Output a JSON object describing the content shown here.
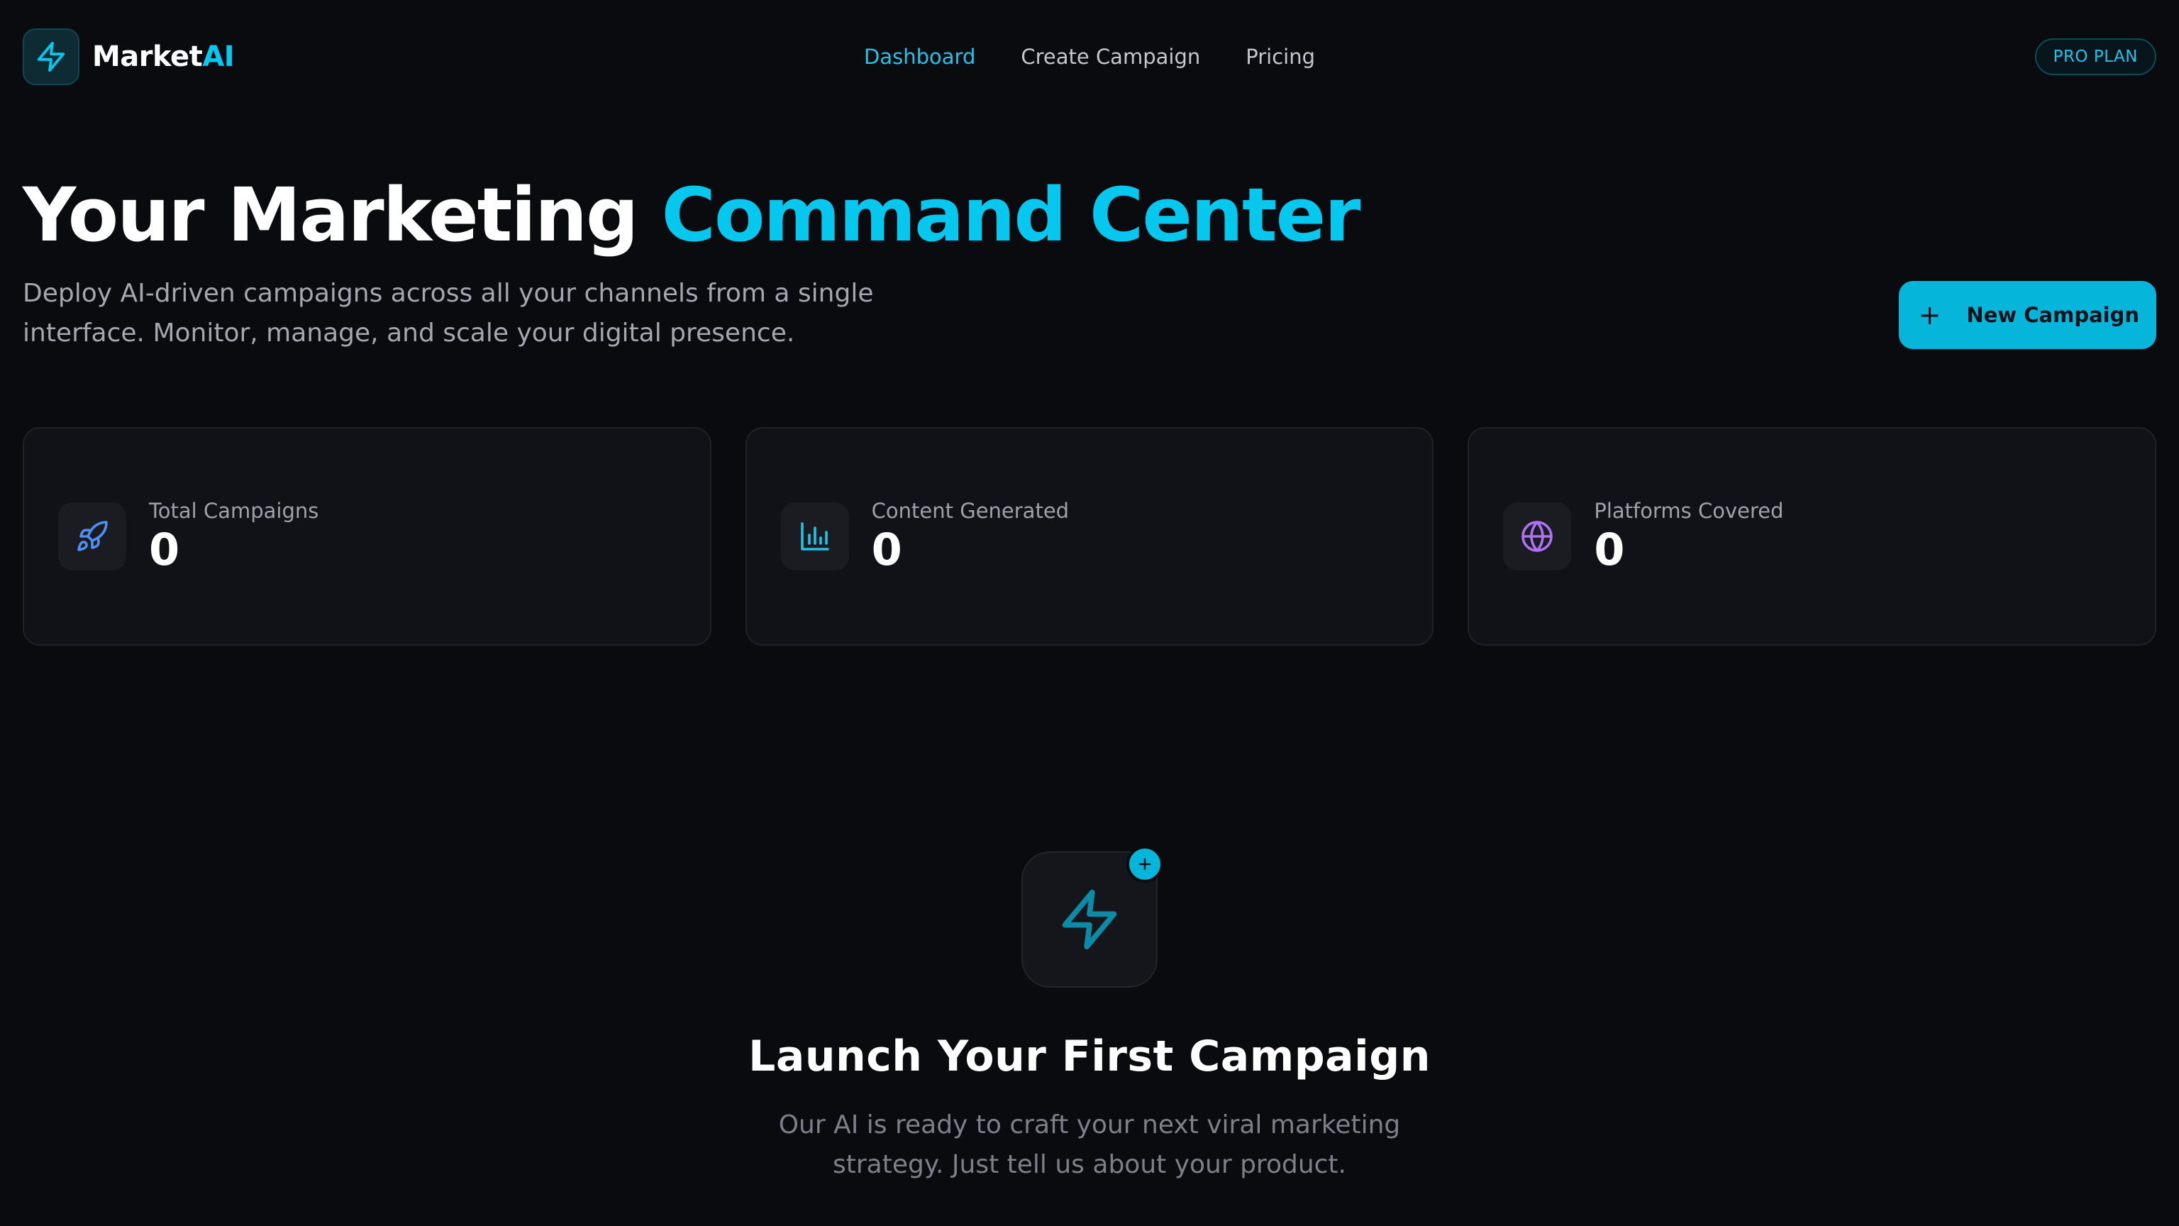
{
  "app": {
    "logo_text": "Market",
    "logo_accent": "AI"
  },
  "nav": {
    "items": [
      {
        "label": "Dashboard",
        "active": true
      },
      {
        "label": "Create Campaign",
        "active": false
      },
      {
        "label": "Pricing",
        "active": false
      }
    ]
  },
  "plan_badge": "PRO PLAN",
  "hero": {
    "title_main": "Your Marketing ",
    "title_accent": "Command Center",
    "subtitle": "Deploy AI-driven campaigns across all your channels from a single interface. Monitor, manage, and scale your digital presence.",
    "new_campaign_label": "New Campaign"
  },
  "stats": [
    {
      "label": "Total Campaigns",
      "value": "0",
      "icon": "rocket-icon",
      "color": "#4f8ff7"
    },
    {
      "label": "Content Generated",
      "value": "0",
      "icon": "bar-chart-icon",
      "color": "#22c3e6"
    },
    {
      "label": "Platforms Covered",
      "value": "0",
      "icon": "globe-icon",
      "color": "#b072f5"
    }
  ],
  "empty_state": {
    "title": "Launch Your First Campaign",
    "description": "Our AI is ready to craft your next viral marketing strategy. Just tell us about your product."
  },
  "colors": {
    "accent": "#06c8ee",
    "background": "#0a0b0f",
    "card": "#111217"
  }
}
